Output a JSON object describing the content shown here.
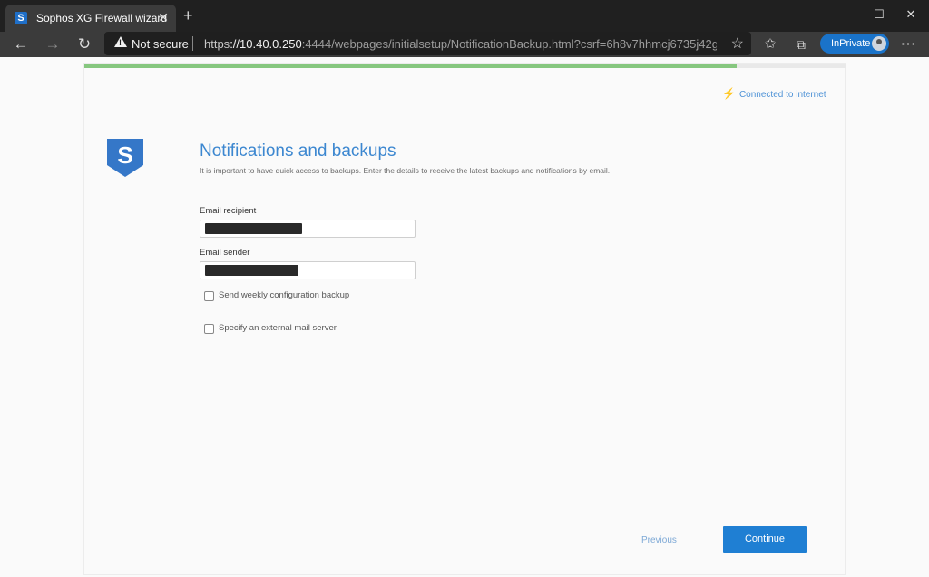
{
  "browser": {
    "tab_title": "Sophos XG Firewall wizard",
    "tab_favicon_letter": "S",
    "new_tab_symbol": "+",
    "security_label": "Not secure",
    "url_scheme": "https",
    "url_host": "://10.40.0.250",
    "url_rest": ":4444/webpages/initialsetup/NotificationBackup.html?csrf=6h8v7hhmcj6735j42g...",
    "inprivate_label": "InPrivate",
    "icons": [
      "back-arrow-icon",
      "forward-arrow-icon",
      "refresh-icon",
      "warning-icon",
      "favorite-star-icon",
      "favorites-icon",
      "collections-icon",
      "more-icon",
      "minimize-icon",
      "maximize-icon",
      "close-icon"
    ]
  },
  "wizard": {
    "progress_fraction": 0.856,
    "progress_color": "#86c77f",
    "connection_status": "Connected to internet",
    "logo_letter": "S",
    "title": "Notifications and backups",
    "subtitle": "It is important to have quick access to backups. Enter the details to receive the latest backups and notifications by email.",
    "fields": {
      "recipient_label": "Email recipient",
      "sender_label": "Email sender"
    },
    "options": {
      "weekly_backup_label": "Send weekly configuration backup",
      "external_mail_label": "Specify an external mail server"
    },
    "buttons": {
      "previous": "Previous",
      "continue": "Continue"
    },
    "accent_color": "#1f7fd3"
  }
}
